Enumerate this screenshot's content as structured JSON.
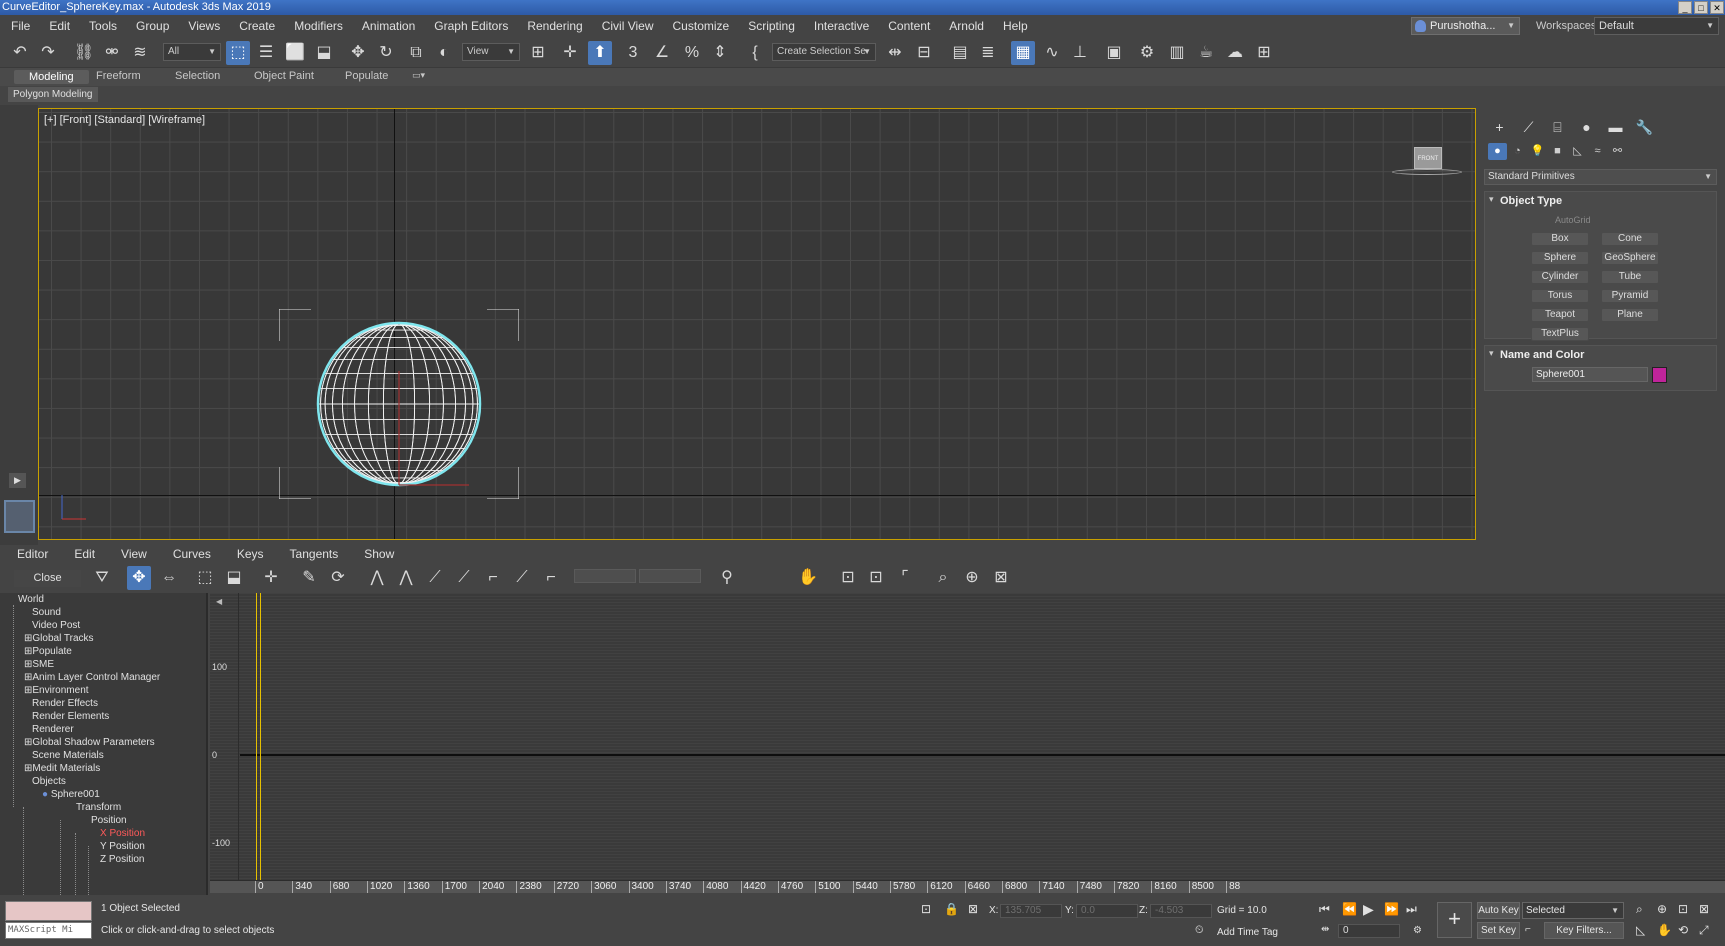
{
  "window": {
    "title": "CurveEditor_SphereKey.max - Autodesk 3ds Max 2019"
  },
  "menu": [
    "File",
    "Edit",
    "Tools",
    "Group",
    "Views",
    "Create",
    "Modifiers",
    "Animation",
    "Graph Editors",
    "Rendering",
    "Civil View",
    "Customize",
    "Scripting",
    "Interactive",
    "Content",
    "Arnold",
    "Help"
  ],
  "user": {
    "name": "Purushotha..."
  },
  "workspaces": {
    "label": "Workspaces:",
    "value": "Default"
  },
  "toolbar": {
    "filter": "All",
    "ref_coord": "View",
    "selection_set": "Create Selection Se"
  },
  "ribbon": {
    "tabs": [
      "Modeling",
      "Freeform",
      "Selection",
      "Object Paint",
      "Populate"
    ],
    "active": "Modeling",
    "sub": "Polygon Modeling"
  },
  "viewport": {
    "label": "[+] [Front] [Standard] [Wireframe]",
    "viewcube_face": "FRONT"
  },
  "command_panel": {
    "category": "Standard Primitives",
    "object_type": {
      "title": "Object Type",
      "autogrid": "AutoGrid",
      "buttons": [
        "Box",
        "Cone",
        "Sphere",
        "GeoSphere",
        "Cylinder",
        "Tube",
        "Torus",
        "Pyramid",
        "Teapot",
        "Plane",
        "TextPlus"
      ]
    },
    "name_color": {
      "title": "Name and Color",
      "name": "Sphere001",
      "color": "#c0249a"
    }
  },
  "curve_editor": {
    "menu": [
      "Editor",
      "Edit",
      "View",
      "Curves",
      "Keys",
      "Tangents",
      "Show"
    ],
    "close_label": "Close",
    "tree": [
      "World",
      "Sound",
      "Video Post",
      "Global Tracks",
      "Populate",
      "SME",
      "Anim Layer Control Manager",
      "Environment",
      "Render Effects",
      "Render Elements",
      "Renderer",
      "Global Shadow Parameters",
      "Scene Materials",
      "Medit Materials",
      "Objects",
      "Sphere001",
      "Transform",
      "Position",
      "X Position",
      "Y Position",
      "Z Position"
    ],
    "y_labels": [
      "100",
      "0",
      "-100"
    ],
    "ruler": [
      "0",
      "340",
      "680",
      "1020",
      "1360",
      "1700",
      "2040",
      "2380",
      "2720",
      "3060",
      "3400",
      "3740",
      "4080",
      "4420",
      "4760",
      "5100",
      "5440",
      "5780",
      "6120",
      "6460",
      "6800",
      "7140",
      "7480",
      "7820",
      "8160",
      "8500",
      "88"
    ]
  },
  "status": {
    "maxscript": "MAXScript Mi",
    "selected": "1 Object Selected",
    "prompt": "Click or click-and-drag to select objects",
    "x_label": "X:",
    "x": "135.705",
    "y_label": "Y:",
    "y": "0.0",
    "z_label": "Z:",
    "z": "-4.503",
    "grid": "Grid = 10.0",
    "add_time_tag": "Add Time Tag",
    "auto_key": "Auto Key",
    "set_key": "Set Key",
    "selected_filter": "Selected",
    "key_filters": "Key Filters...",
    "frame": "0"
  }
}
